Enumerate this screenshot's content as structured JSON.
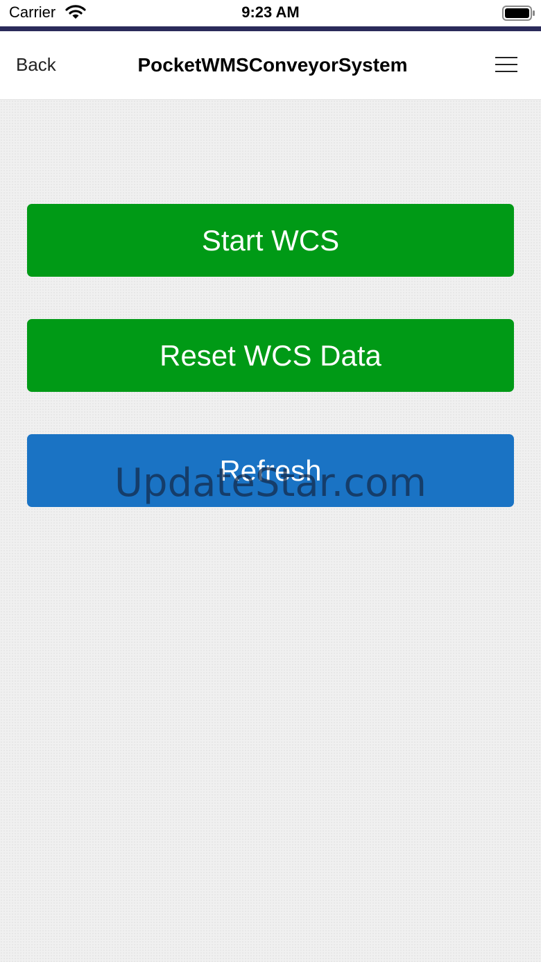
{
  "status_bar": {
    "carrier": "Carrier",
    "time": "9:23 AM",
    "icons": [
      "wifi-icon",
      "battery-icon"
    ]
  },
  "nav": {
    "back_label": "Back",
    "title": "PocketWMSConveyorSystem",
    "menu_icon": "hamburger-menu-icon"
  },
  "actions": {
    "start_label": "Start WCS",
    "reset_label": "Reset WCS Data",
    "refresh_label": "Refresh"
  },
  "watermark": "UpdateStar.com",
  "colors": {
    "accent_line": "#2a2a5a",
    "start_button": "#009a16",
    "reset_button": "#009a16",
    "refresh_button": "#1a73c4",
    "content_background": "#f0f0f0"
  }
}
